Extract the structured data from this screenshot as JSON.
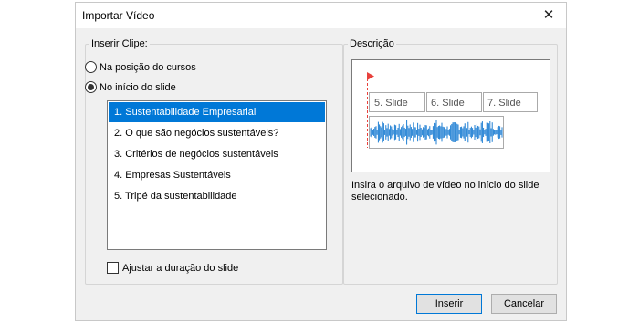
{
  "dialog": {
    "title": "Importar Vídeo",
    "close_glyph": "✕"
  },
  "insert_clip": {
    "legend": "Inserir Clipe:",
    "options": [
      {
        "label": "Na posição do cursos",
        "selected": false
      },
      {
        "label": "No início do slide",
        "selected": true
      }
    ],
    "slides": [
      "1. Sustentabilidade Empresarial",
      "2. O que são negócios sustentáveis?",
      "3. Critérios de negócios sustentáveis",
      "4. Empresas Sustentáveis",
      "5. Tripé da sustentabilidade"
    ],
    "selected_index": 0,
    "fit_duration": {
      "label": "Ajustar a duração do slide",
      "checked": false
    }
  },
  "description": {
    "legend": "Descrição",
    "preview_slides": [
      "5. Slide",
      "6. Slide",
      "7. Slide"
    ],
    "text": "Insira o arquivo de vídeo no início do slide selecionado."
  },
  "buttons": {
    "insert": "Inserir",
    "cancel": "Cancelar"
  },
  "colors": {
    "selection": "#0078d7",
    "waveform": "#1f7fd3",
    "marker": "#e8413c"
  }
}
